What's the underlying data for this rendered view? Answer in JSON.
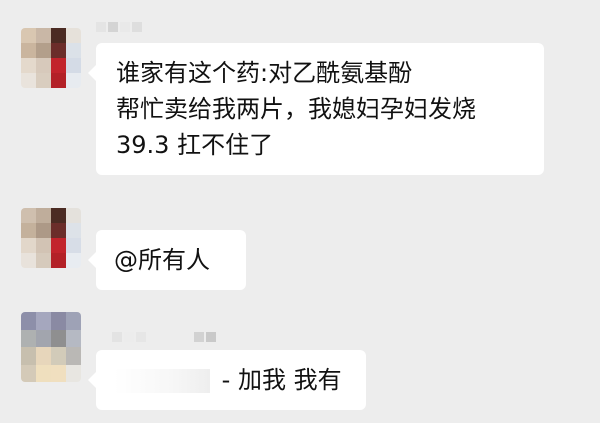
{
  "chat": {
    "messages": [
      {
        "lines": [
          "谁家有这个药:对乙酰氨基酚",
          "帮忙卖给我两片，我媳妇孕妇发烧",
          "39.3 扛不住了"
        ]
      },
      {
        "lines": [
          "@所有人"
        ]
      },
      {
        "mention_prefix": "-",
        "text": "加我 我有"
      }
    ]
  },
  "colors": {
    "background": "#ededed",
    "bubble": "#ffffff",
    "text": "#111111"
  }
}
